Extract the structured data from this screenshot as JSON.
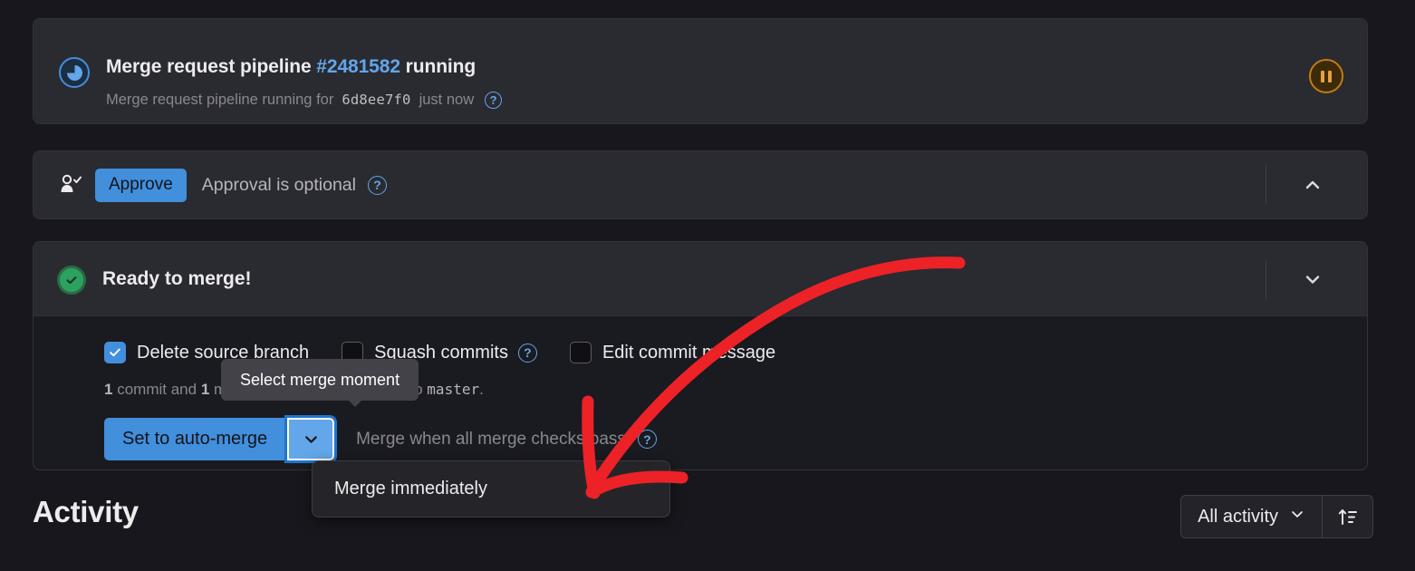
{
  "pipeline": {
    "icon": "pipeline-running-icon",
    "title_prefix": "Merge request pipeline",
    "pipeline_id": "#2481582",
    "title_suffix": "running",
    "subtitle_prefix": "Merge request pipeline running for",
    "commit_sha": "6d8ee7f0",
    "time_ago": "just now",
    "help": "?",
    "pause_action": "pause-pipeline",
    "accent_color": "#63a6e9",
    "pause_color": "#e9a13b"
  },
  "approval": {
    "icon": "user-approve-icon",
    "approve_label": "Approve",
    "note": "Approval is optional",
    "help": "?",
    "collapse_icon": "chevron-up-icon",
    "button_color": "#428fdc"
  },
  "merge": {
    "icon": "success-check-icon",
    "title": "Ready to merge!",
    "collapse_icon": "chevron-down-icon",
    "status_color": "#2da160",
    "checkboxes": [
      {
        "label": "Delete source branch",
        "checked": true,
        "help": false
      },
      {
        "label": "Squash commits",
        "checked": false,
        "help": true
      },
      {
        "label": "Edit commit message",
        "checked": false,
        "help": false
      }
    ],
    "commit_count": "1",
    "commit_text_1": "commit and",
    "merge_commit_count": "1",
    "commit_text_2": "merge commit will be added to",
    "target_branch": "master",
    "commit_text_end": ".",
    "merge_button_label": "Set to auto-merge",
    "dropdown_icon": "chevron-down-icon",
    "merge_hint": "Merge when all merge checks pass",
    "help": "?",
    "tooltip": "Select merge moment",
    "dropdown_options": [
      "Merge immediately"
    ]
  },
  "activity": {
    "title": "Activity",
    "filter_label": "All activity",
    "filter_icon": "chevron-down-icon",
    "sort_icon": "sort-ascending-icon"
  },
  "annotation": {
    "color": "#ec2227",
    "type": "hand-drawn-arrow"
  }
}
